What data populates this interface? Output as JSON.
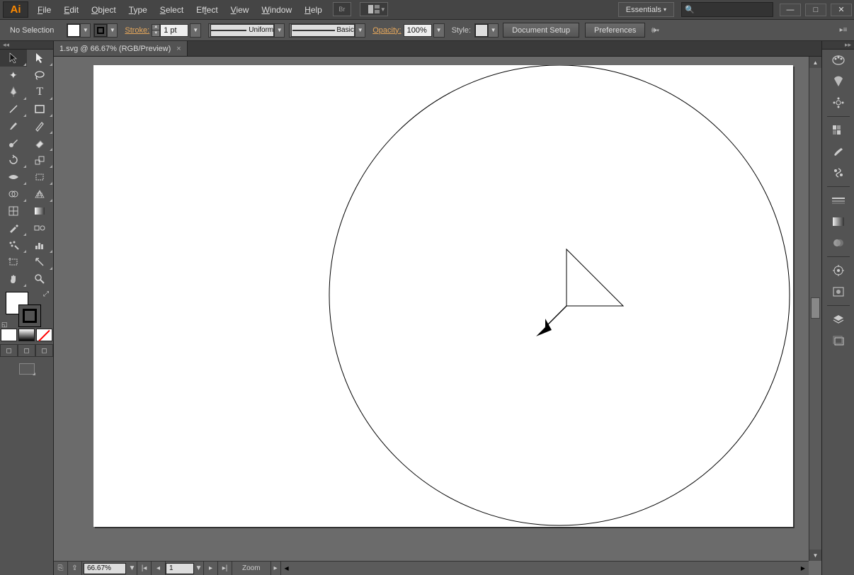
{
  "app": {
    "logo": "Ai"
  },
  "menu": {
    "file": {
      "label": "File",
      "hotchar": "F"
    },
    "edit": {
      "label": "Edit",
      "hotchar": "E"
    },
    "object": {
      "label": "Object",
      "hotchar": "O"
    },
    "type": {
      "label": "Type",
      "hotchar": "T"
    },
    "select": {
      "label": "Select",
      "hotchar": "S"
    },
    "effect": {
      "label": "Effect",
      "hotchar": "f"
    },
    "view": {
      "label": "View",
      "hotchar": "V"
    },
    "window": {
      "label": "Window",
      "hotchar": "W"
    },
    "help": {
      "label": "Help",
      "hotchar": "H"
    }
  },
  "bridge_label": "Br",
  "workspace": {
    "label": "Essentials"
  },
  "search": {
    "placeholder": ""
  },
  "window_buttons": {
    "min": "—",
    "max": "□",
    "close": "✕"
  },
  "control": {
    "selection_status": "No Selection",
    "stroke_label": "Stroke:",
    "stroke_value": "1 pt",
    "profile_label": "Uniform",
    "brush_label": "Basic",
    "opacity_label": "Opacity:",
    "opacity_value": "100%",
    "style_label": "Style:",
    "doc_setup": "Document Setup",
    "preferences": "Preferences"
  },
  "tab": {
    "title": "1.svg @ 66.67% (RGB/Preview)"
  },
  "status": {
    "zoom": "66.67%",
    "page": "1",
    "tool": "Zoom"
  },
  "tools": {
    "names": [
      "selection-tool",
      "direct-selection-tool",
      "magic-wand-tool",
      "lasso-tool",
      "pen-tool",
      "type-tool",
      "line-tool",
      "rectangle-tool",
      "paintbrush-tool",
      "pencil-tool",
      "blob-brush-tool",
      "eraser-tool",
      "rotate-tool",
      "scale-tool",
      "width-tool",
      "free-transform-tool",
      "shape-builder-tool",
      "perspective-grid-tool",
      "mesh-tool",
      "gradient-tool",
      "eyedropper-tool",
      "blend-tool",
      "symbol-sprayer-tool",
      "column-graph-tool",
      "artboard-tool",
      "slice-tool",
      "hand-tool",
      "zoom-tool"
    ]
  },
  "right_panel": {
    "icons": [
      "color-panel",
      "color-guide-panel",
      "kuler-panel",
      "swatches-panel",
      "brushes-panel",
      "symbols-panel",
      "stroke-panel",
      "gradient-panel",
      "transparency-panel",
      "appearance-panel",
      "graphic-styles-panel",
      "layers-panel",
      "artboards-panel"
    ]
  }
}
